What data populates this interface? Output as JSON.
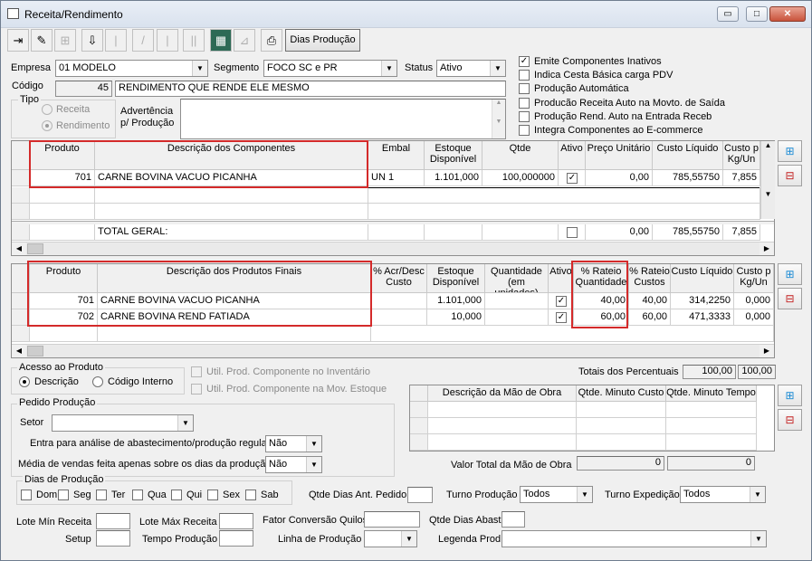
{
  "window": {
    "title": "Receita/Rendimento"
  },
  "toolbar": {
    "dias_producao": "Dias Produção"
  },
  "header": {
    "empresa_label": "Empresa",
    "empresa_value": "01 MODELO",
    "segmento_label": "Segmento",
    "segmento_value": "FOCO SC e PR",
    "status_label": "Status",
    "status_value": "Ativo",
    "codigo_label": "Código",
    "codigo_value": "45",
    "descricao_value": "RENDIMENTO QUE RENDE ELE MESMO",
    "tipo_label": "Tipo",
    "tipo_receita": "Receita",
    "tipo_rendimento": "Rendimento",
    "advertencia_label_1": "Advertência",
    "advertencia_label_2": "p/ Produção"
  },
  "options": [
    {
      "label": "Emite Componentes Inativos",
      "checked": true
    },
    {
      "label": "Indica Cesta Básica carga PDV",
      "checked": false
    },
    {
      "label": "Produção Automática",
      "checked": false
    },
    {
      "label": "Producão Receita Auto na Movto. de Saída",
      "checked": false
    },
    {
      "label": "Produção Rend. Auto na Entrada Receb",
      "checked": false
    },
    {
      "label": "Integra Componentes ao E-commerce",
      "checked": false
    }
  ],
  "components": {
    "headers": {
      "produto": "Produto",
      "descricao": "Descrição dos Componentes",
      "embal": "Embal",
      "estoque": "Estoque Disponível",
      "qtde": "Qtde",
      "ativo": "Ativo",
      "preco": "Preço Unitário",
      "custo": "Custo Líquido",
      "custo_kg": "Custo p Kg/Un"
    },
    "rows": [
      {
        "produto": "701",
        "descricao": "CARNE BOVINA VACUO PICANHA",
        "embal": "UN  1",
        "estoque": "1.101,000",
        "qtde": "100,000000",
        "ativo": "✓",
        "preco": "0,00",
        "custo": "785,55750",
        "custo_kg": "7,855"
      }
    ],
    "total": {
      "label": "TOTAL GERAL:",
      "preco": "0,00",
      "custo": "785,55750",
      "custo_kg": "7,855"
    }
  },
  "final_products": {
    "headers": {
      "produto": "Produto",
      "descricao": "Descrição dos Produtos Finais",
      "acr": "% Acr/Desc Custo",
      "estoque": "Estoque Disponível",
      "quantidade": "Quantidade (em unidades)",
      "ativo": "Ativo",
      "rateio_qtd": "% Rateio Quantidade",
      "rateio_custos": "% Rateio Custos",
      "custo": "Custo Líquido",
      "custo_kg": "Custo p Kg/Un"
    },
    "rows": [
      {
        "produto": "701",
        "descricao": "CARNE BOVINA VACUO PICANHA",
        "estoque": "1.101,000",
        "ativo": "✓",
        "rateio_qtd": "40,00",
        "rateio_custos": "40,00",
        "custo": "314,2250",
        "custo_kg": "0,000"
      },
      {
        "produto": "702",
        "descricao": "CARNE BOVINA REND FATIADA",
        "estoque": "10,000",
        "ativo": "✓",
        "rateio_qtd": "60,00",
        "rateio_custos": "60,00",
        "custo": "471,3333",
        "custo_kg": "0,000"
      }
    ]
  },
  "acesso": {
    "label": "Acesso ao Produto",
    "descricao": "Descrição",
    "codigo": "Código Interno"
  },
  "util": {
    "inventario": "Util. Prod. Componente no Inventário",
    "mov": "Util. Prod. Componente na Mov. Estoque"
  },
  "totais": {
    "label": "Totais dos Percentuais",
    "v1": "100,00",
    "v2": "100,00"
  },
  "mao_obra": {
    "headers": {
      "descricao": "Descrição da Mão de Obra",
      "minuto_custo": "Qtde. Minuto Custo",
      "minuto_tempo": "Qtde. Minuto Tempo"
    },
    "valor_label": "Valor Total da Mão de Obra",
    "valor1": "0",
    "valor2": "0"
  },
  "pedido": {
    "label": "Pedido Produção",
    "setor_label": "Setor",
    "entra_label": "Entra para análise de abastecimento/produção regular",
    "entra_value": "Não",
    "media_label": "Média de vendas feita apenas sobre os dias da produção",
    "media_value": "Não",
    "dias_label": "Dias de Produção",
    "dias": [
      "Dom",
      "Seg",
      "Ter",
      "Qua",
      "Qui",
      "Sex",
      "Sab"
    ]
  },
  "bottom": {
    "qtde_dias_ant": "Qtde Dias Ant. Pedido",
    "turno_producao_label": "Turno Produção",
    "turno_producao_value": "Todos",
    "turno_expedicao_label": "Turno Expedição",
    "turno_expedicao_value": "Todos",
    "lote_min": "Lote Mín Receita",
    "lote_max": "Lote Máx Receita",
    "fator": "Fator Conversão Quilos",
    "qtde_dias_abast": "Qtde Dias Abast",
    "setup": "Setup",
    "tempo_producao": "Tempo Produção",
    "linha_producao": "Linha de Produção",
    "legenda_prod": "Legenda Prod"
  }
}
